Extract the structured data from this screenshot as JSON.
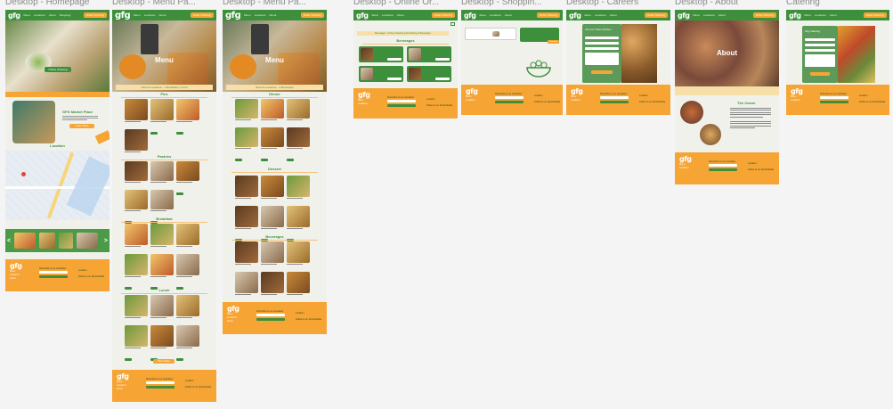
{
  "frames": {
    "home": "Desktop - Homepage",
    "menu1": "Desktop - Menu Pa...",
    "menu2": "Desktop - Menu Pa...",
    "online": "Desktop - Online Or...",
    "shopping": "Desktop - Shoppin...",
    "careers": "Desktop - Careers",
    "about": "Desktop - About",
    "catering": "Catering"
  },
  "nav": {
    "logo": "gfg",
    "links": [
      "Menu",
      "Locations",
      "About",
      "Shopping",
      "Careers"
    ],
    "order_label": "Order Ordering"
  },
  "home": {
    "hero_button": "Online Ordering",
    "market_title": "GFG Market Place",
    "market_button": "Learn More",
    "location_title": "Location",
    "carousel_prev": "<",
    "carousel_next": ">"
  },
  "menu1": {
    "hero_title": "Menu",
    "banner": "Glow & Locations - 1 Breakfast / Lunch",
    "sections": [
      "Pies",
      "Pastries",
      "Breakfast",
      "Lunch"
    ],
    "more_button": "View More"
  },
  "menu2": {
    "hero_title": "Menu",
    "banner": "Glow & Locations - 1 Beverages",
    "sections": [
      "Dinner",
      "Dessert",
      "Beverages"
    ]
  },
  "online": {
    "banner": "Beverages - Online Ordering and Ordering to Beverages",
    "section": "Beverages"
  },
  "shopping": {
    "button": "Checkout"
  },
  "careers": {
    "title": "Join our Team Kitchen"
  },
  "about": {
    "hero_title": "About",
    "owner_title": "The Owner"
  },
  "catering": {
    "title": "Gfg Catering"
  },
  "footer": {
    "logo": "gfg",
    "subscribe": "Subscribe to our newsletter",
    "button": "Subscribe",
    "location": "Location",
    "follow": "Follow us on Social Media"
  },
  "colors": {
    "green": "#3e8f3c",
    "orange": "#f6a434",
    "cream": "#f1f1ec",
    "canvas": "#f4f4f4"
  }
}
